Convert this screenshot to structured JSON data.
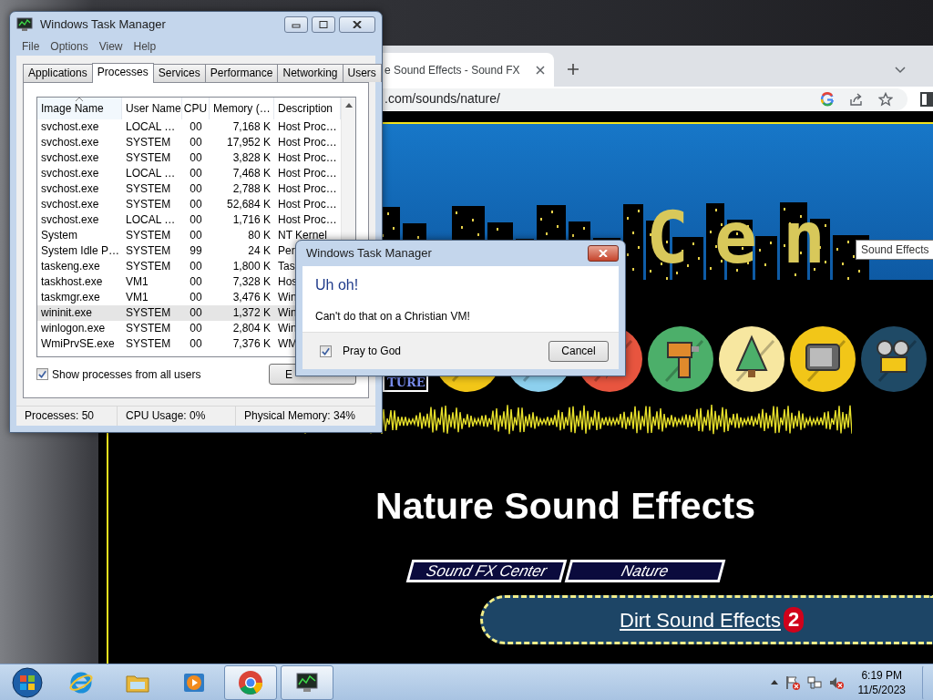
{
  "browser": {
    "tab_title": "e Sound Effects - Sound FX",
    "address": ".com/sounds/nature/",
    "page": {
      "sign_text": "Cen",
      "tooltip": "Sound Effects",
      "logo_text": "TURE",
      "title": "Nature Sound Effects",
      "breadcrumbs": [
        "Sound FX Center",
        "Nature"
      ],
      "categories": [
        {
          "label": "Dirt Sound Effects",
          "badge": "2"
        }
      ]
    }
  },
  "task_manager": {
    "title": "Windows Task Manager",
    "menu": [
      "File",
      "Options",
      "View",
      "Help"
    ],
    "tabs": [
      {
        "label": "Applications",
        "selected": false
      },
      {
        "label": "Processes",
        "selected": true
      },
      {
        "label": "Services",
        "selected": false
      },
      {
        "label": "Performance",
        "selected": false
      },
      {
        "label": "Networking",
        "selected": false
      },
      {
        "label": "Users",
        "selected": false
      }
    ],
    "columns": [
      "Image Name",
      "User Name",
      "CPU",
      "Memory (…",
      "Description"
    ],
    "rows": [
      {
        "cells": [
          "svchost.exe",
          "LOCAL …",
          "00",
          "7,168 K",
          "Host Proc…"
        ],
        "selected": false
      },
      {
        "cells": [
          "svchost.exe",
          "SYSTEM",
          "00",
          "17,952 K",
          "Host Proc…"
        ],
        "selected": false
      },
      {
        "cells": [
          "svchost.exe",
          "SYSTEM",
          "00",
          "3,828 K",
          "Host Proc…"
        ],
        "selected": false
      },
      {
        "cells": [
          "svchost.exe",
          "LOCAL …",
          "00",
          "7,468 K",
          "Host Proc…"
        ],
        "selected": false
      },
      {
        "cells": [
          "svchost.exe",
          "SYSTEM",
          "00",
          "2,788 K",
          "Host Proc…"
        ],
        "selected": false
      },
      {
        "cells": [
          "svchost.exe",
          "SYSTEM",
          "00",
          "52,684 K",
          "Host Proc…"
        ],
        "selected": false
      },
      {
        "cells": [
          "svchost.exe",
          "LOCAL …",
          "00",
          "1,716 K",
          "Host Proc…"
        ],
        "selected": false
      },
      {
        "cells": [
          "System",
          "SYSTEM",
          "00",
          "80 K",
          "NT Kernel"
        ],
        "selected": false
      },
      {
        "cells": [
          "System Idle P…",
          "SYSTEM",
          "99",
          "24 K",
          "Per"
        ],
        "selected": false
      },
      {
        "cells": [
          "taskeng.exe",
          "SYSTEM",
          "00",
          "1,800 K",
          "Tas"
        ],
        "selected": false
      },
      {
        "cells": [
          "taskhost.exe",
          "VM1",
          "00",
          "7,328 K",
          "Hos"
        ],
        "selected": false
      },
      {
        "cells": [
          "taskmgr.exe",
          "VM1",
          "00",
          "3,476 K",
          "Win"
        ],
        "selected": false
      },
      {
        "cells": [
          "wininit.exe",
          "SYSTEM",
          "00",
          "1,372 K",
          "Win"
        ],
        "selected": true
      },
      {
        "cells": [
          "winlogon.exe",
          "SYSTEM",
          "00",
          "2,804 K",
          "Win"
        ],
        "selected": false
      },
      {
        "cells": [
          "WmiPrvSE.exe",
          "SYSTEM",
          "00",
          "7,376 K",
          "WM"
        ],
        "selected": false
      }
    ],
    "show_all_users": {
      "label": "Show processes from all users",
      "checked": true
    },
    "end_button": "E",
    "status_bar": [
      "Processes: 50",
      "CPU Usage: 0%",
      "Physical Memory: 34%"
    ]
  },
  "dialog": {
    "title": "Windows Task Manager",
    "heading": "Uh oh!",
    "message": "Can't do that on a Christian VM!",
    "checkbox": {
      "label": "Pray to God",
      "checked": true
    },
    "button": "Cancel"
  },
  "taskbar": {
    "apps": [
      {
        "kind": "ie",
        "running": false
      },
      {
        "kind": "explorer",
        "running": false
      },
      {
        "kind": "media",
        "running": false
      },
      {
        "kind": "chrome",
        "running": true
      },
      {
        "kind": "taskmgr",
        "running": true
      }
    ],
    "clock": {
      "time": "6:19 PM",
      "date": "11/5/2023"
    }
  }
}
